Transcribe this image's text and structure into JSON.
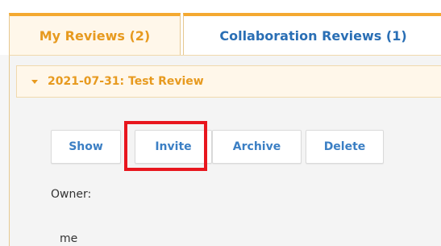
{
  "tabs": [
    {
      "label": "My Reviews (2)",
      "active": true
    },
    {
      "label": "Collaboration Reviews (1)",
      "active": false
    }
  ],
  "review": {
    "title": "2021-07-31: Test Review",
    "expanded": true,
    "buttons": {
      "show": "Show",
      "invite": "Invite",
      "archive": "Archive",
      "delete": "Delete"
    },
    "owner_label": "Owner:",
    "owner_value": "me"
  },
  "highlight": {
    "target": "invite-button",
    "color": "#e8161e"
  },
  "colors": {
    "accent": "#f4a930",
    "active_tab_text": "#e79a1f",
    "link": "#2a6fb5"
  }
}
